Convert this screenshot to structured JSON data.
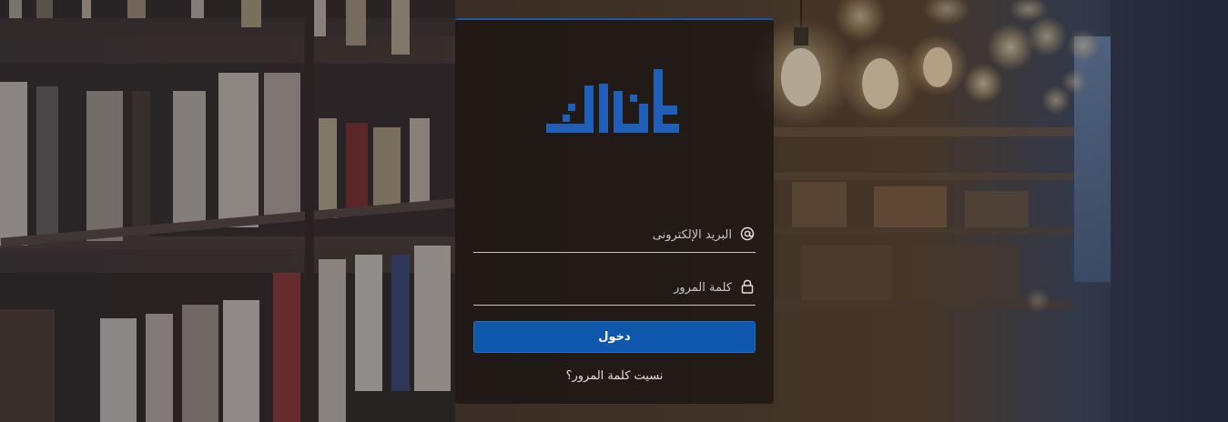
{
  "brand": {
    "name": "كتابك",
    "color": "#1f5fb8"
  },
  "form": {
    "email_placeholder": "البريد الإلكترونى",
    "password_placeholder": "كلمة المرور",
    "login_label": "دخول",
    "forgot_label": "نسيت كلمة المرور؟"
  },
  "icons": {
    "email": "at-icon",
    "password": "lock-icon"
  },
  "colors": {
    "accent": "#0f57ad",
    "panel_border": "#1e56a6"
  }
}
